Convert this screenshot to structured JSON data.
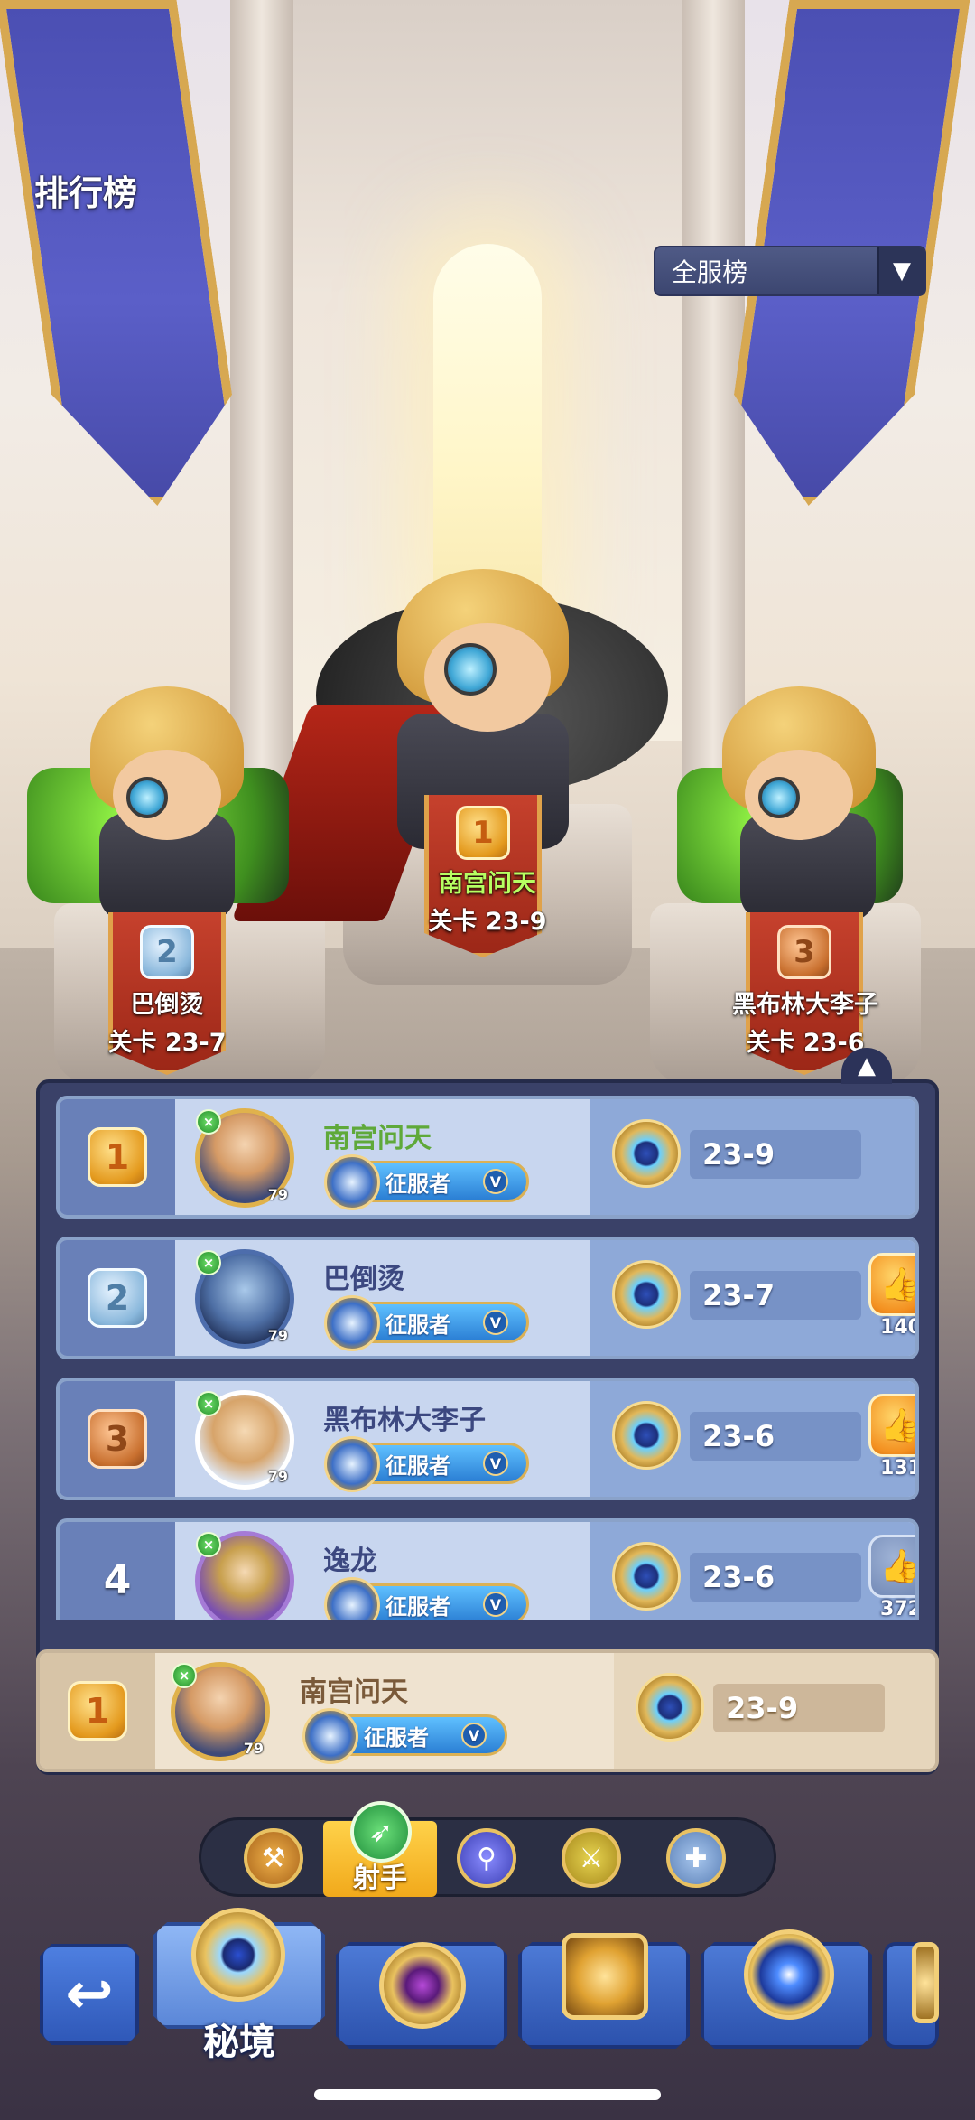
{
  "header": {
    "title": "排行榜",
    "server_filter": {
      "selected": "全服榜",
      "caret": "▼"
    }
  },
  "podium": [
    {
      "rank": "1",
      "name": "南宫问天",
      "stage": "关卡 23-9"
    },
    {
      "rank": "2",
      "name": "巴倒烫",
      "stage": "关卡 23-7"
    },
    {
      "rank": "3",
      "name": "黑布林大李子",
      "stage": "关卡 23-6"
    }
  ],
  "ranking": {
    "collapse_icon": "▲",
    "rows": [
      {
        "rank": "1",
        "name": "南宫问天",
        "level": "79",
        "title": "征服者",
        "stage": "23-9"
      },
      {
        "rank": "2",
        "name": "巴倒烫",
        "level": "79",
        "title": "征服者",
        "stage": "23-7",
        "likes": "140"
      },
      {
        "rank": "3",
        "name": "黑布林大李子",
        "level": "79",
        "title": "征服者",
        "stage": "23-6",
        "likes": "131"
      },
      {
        "rank": "4",
        "name": "逸龙",
        "level": "",
        "title": "征服者",
        "stage": "23-6",
        "likes": "372"
      }
    ],
    "self": {
      "rank": "1",
      "name": "南宫问天",
      "level": "79",
      "title": "征服者",
      "stage": "23-9"
    },
    "title_badge_suffix": "V",
    "like_icon": "👍"
  },
  "class_filter": {
    "active_label": "射手",
    "icons": [
      "axe-icon",
      "bow-icon",
      "staff-icon",
      "dagger-icon",
      "holy-icon"
    ]
  },
  "bottom_nav": {
    "back_icon": "↩",
    "active_label": "秘境",
    "tiles": [
      "secret-realm-emblem",
      "purple-gem-emblem",
      "crown-emblem",
      "star-emblem",
      "partial-emblem"
    ]
  },
  "colors": {
    "panel": "#3a4168",
    "row": "#c8d6ef",
    "self_row": "#efe3d0",
    "accent_gold": "#e8c162",
    "top_name_green": "#5fa93a"
  }
}
